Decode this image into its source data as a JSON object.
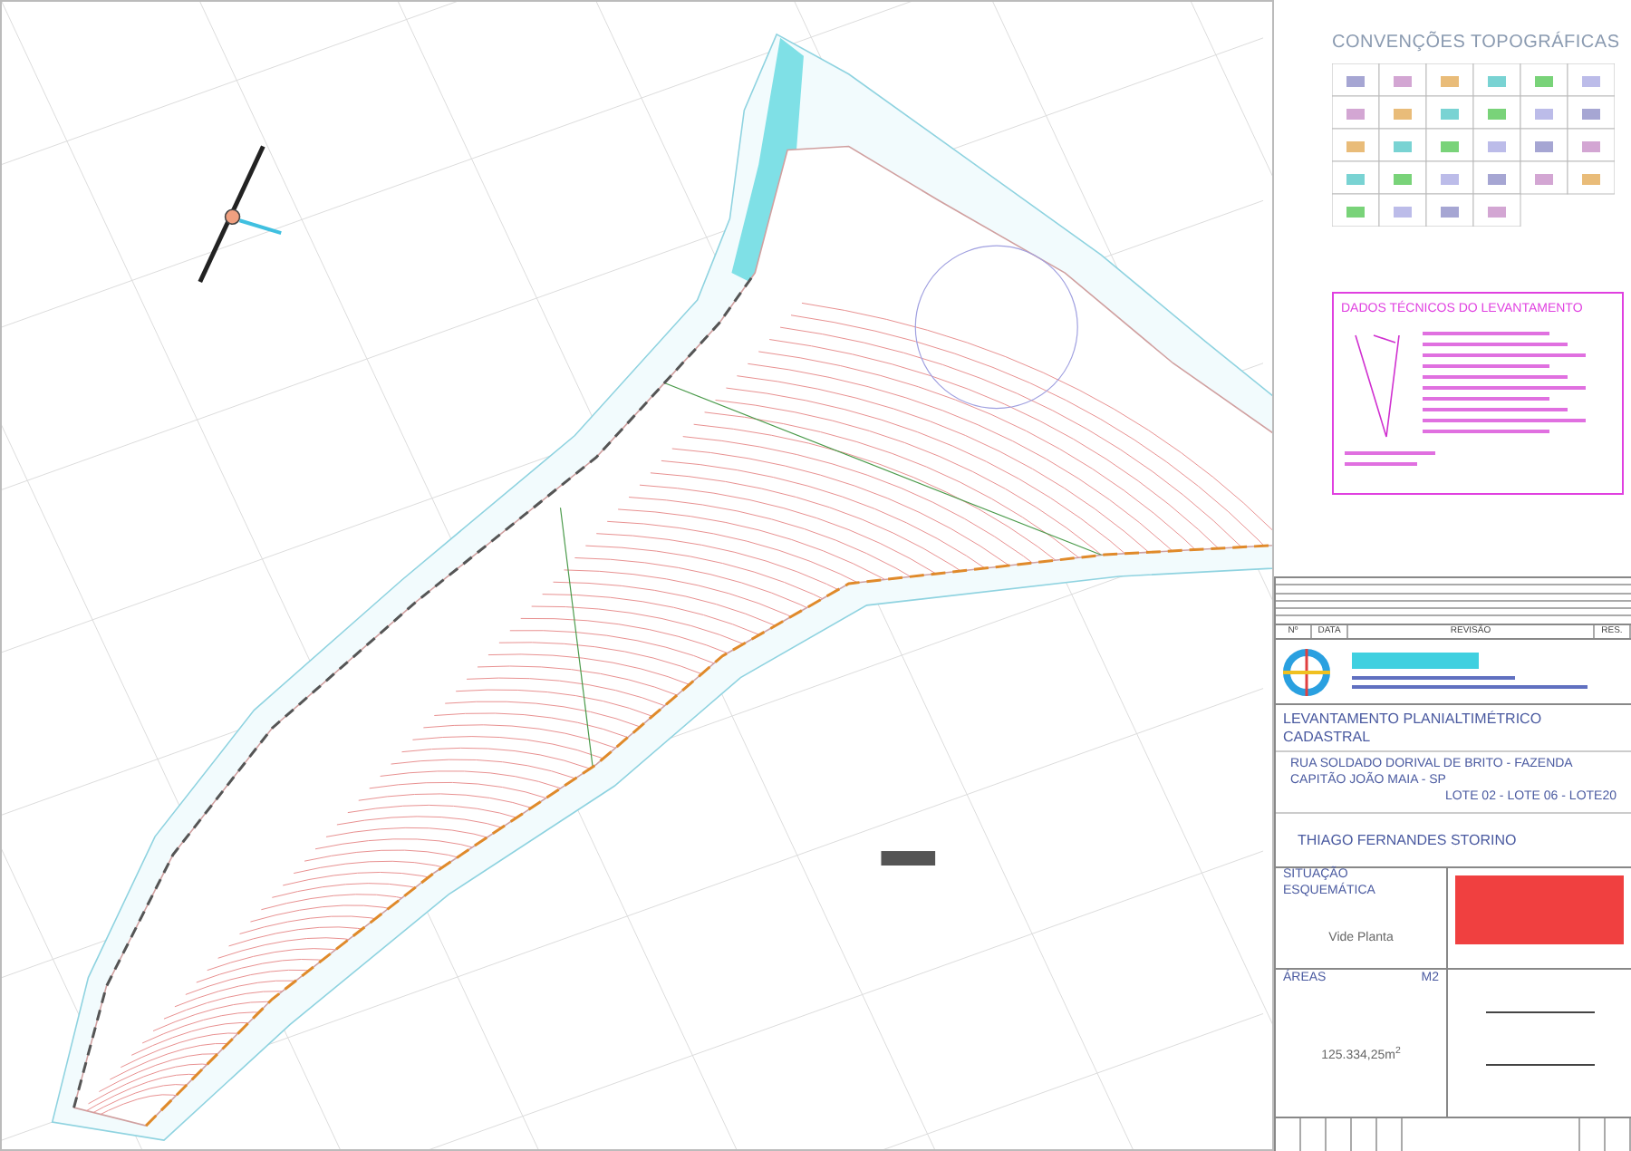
{
  "legend": {
    "title": "CONVENÇÕES TOPOGRÁFICAS"
  },
  "technical_data": {
    "title": "DADOS TÉCNICOS DO LEVANTAMENTO"
  },
  "revisions": {
    "columns": [
      "Nº",
      "DATA",
      "REVISÃO",
      "RES."
    ]
  },
  "title_block": {
    "project_title": "LEVANTAMENTO PLANIALTIMÉTRICO CADASTRAL",
    "address": "RUA SOLDADO DORIVAL DE BRITO - FAZENDA CAPITÃO JOÃO MAIA - SP",
    "lots": "LOTE 02 - LOTE 06 - LOTE20",
    "owner": "THIAGO FERNANDES STORINO"
  },
  "location": {
    "title": "SITUAÇÃO ESQUEMÁTICA",
    "note": "Vide Planta"
  },
  "areas": {
    "title": "ÁREAS",
    "unit": "M2",
    "total": "125.334,25m$^{2}$"
  }
}
